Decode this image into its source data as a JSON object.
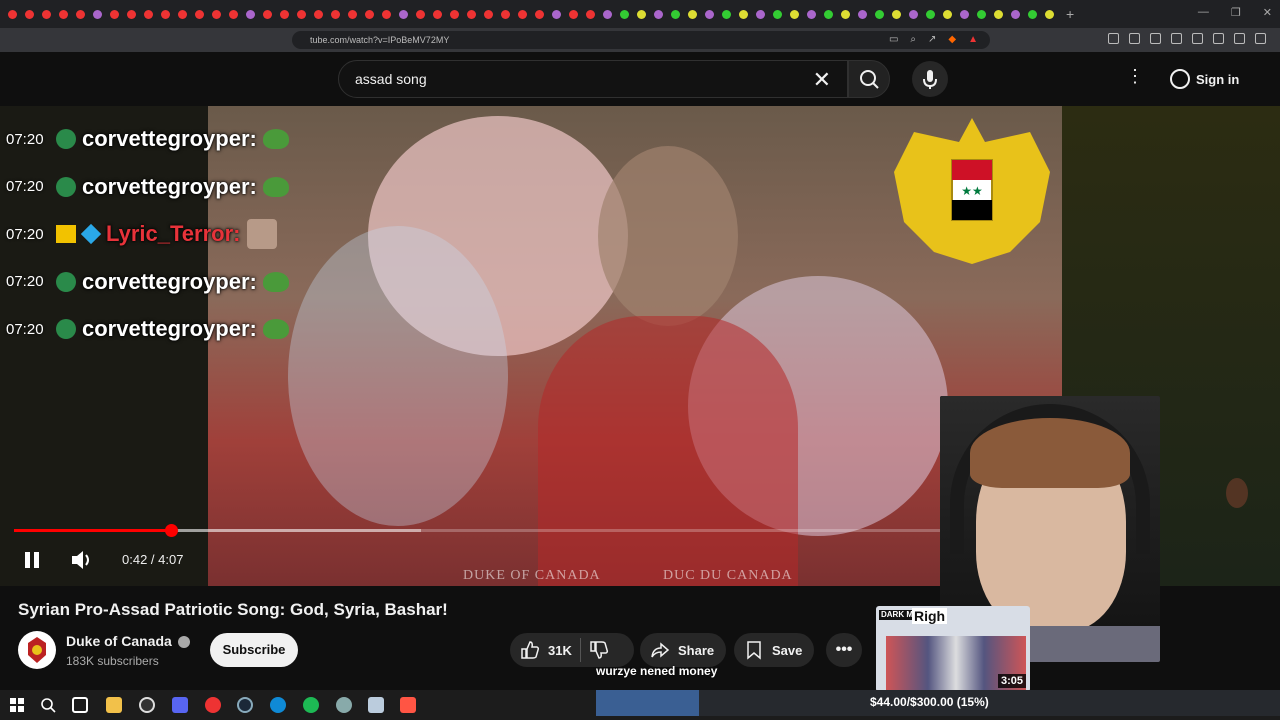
{
  "browser": {
    "url": "tube.com/watch?v=IPoBeMV72MY"
  },
  "youtube_header": {
    "search_query": "assad song",
    "signin_label": "Sign in"
  },
  "player": {
    "current_time": "0:42",
    "duration": "4:07",
    "time_display": "0:42 / 4:07",
    "progress_fraction": 0.17,
    "buffered_fraction": 0.44,
    "watermark_left": "DUKE OF CANADA",
    "watermark_right": "DUC DU CANADA"
  },
  "chat": [
    {
      "time": "07:20",
      "user": "corvettegroyper:",
      "color": "#ffffff"
    },
    {
      "time": "07:20",
      "user": "corvettegroyper:",
      "color": "#ffffff"
    },
    {
      "time": "07:20",
      "user": "Lyric_Terror:",
      "color": "#e8333a"
    },
    {
      "time": "07:20",
      "user": "corvettegroyper:",
      "color": "#ffffff"
    },
    {
      "time": "07:20",
      "user": "corvettegroyper:",
      "color": "#ffffff"
    }
  ],
  "video_info": {
    "title": "Syrian Pro-Assad Patriotic Song: God, Syria, Bashar!",
    "channel": "Duke of Canada",
    "subscribers": "183K subscribers",
    "subscribe_label": "Subscribe",
    "likes": "31K",
    "share_label": "Share",
    "save_label": "Save"
  },
  "overlay": {
    "caption": "wurzye nened money",
    "thumb_tag": "DARK MAGA",
    "thumb_title": "Righ",
    "thumb_duration": "3:05",
    "donation_text": "$44.00/$300.00 (15%)",
    "donation_fraction": 0.15
  },
  "colors": {
    "accent_red": "#ff0000",
    "bg": "#0f0f0f",
    "donation_bar": "#3a5f93"
  }
}
